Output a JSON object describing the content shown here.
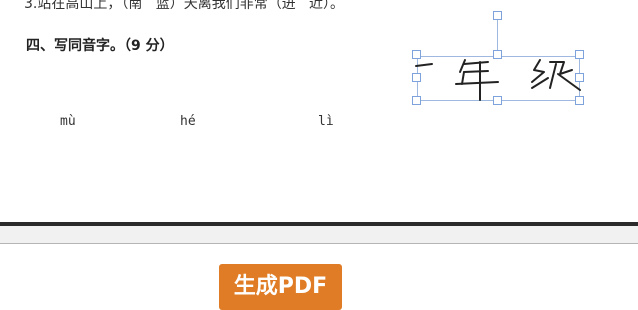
{
  "document": {
    "question3_text": "3.站在高山上，（南   蓝）天离我们非常（进   近）。",
    "section4_title": "四、写同音字。（9 分）",
    "pinyin": [
      "mù",
      "hé",
      "lì"
    ]
  },
  "handwriting": {
    "text": "一年级",
    "selection_color": "#9fb8e0"
  },
  "actions": {
    "generate_pdf_label": "生成PDF",
    "button_color": "#df7c25"
  }
}
